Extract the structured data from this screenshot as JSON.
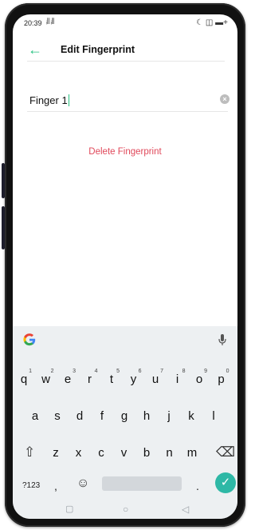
{
  "status_bar": {
    "time": "20:39",
    "signal": "ᵢ⦀ ᵢ⦀",
    "icons_right": "☾ ◫ ▬+"
  },
  "app_bar": {
    "back_icon": "arrow-left-icon",
    "title": "Edit Fingerprint"
  },
  "name_field": {
    "value": "Finger 1"
  },
  "delete_label": "Delete Fingerprint",
  "colors": {
    "accent": "#27c281",
    "danger": "#e0485a",
    "enter": "#2eb8a6",
    "keyboard_bg": "#edf0f2"
  },
  "keyboard": {
    "row1": [
      {
        "k": "q",
        "n": "1"
      },
      {
        "k": "w",
        "n": "2"
      },
      {
        "k": "e",
        "n": "3"
      },
      {
        "k": "r",
        "n": "4"
      },
      {
        "k": "t",
        "n": "5"
      },
      {
        "k": "y",
        "n": "6"
      },
      {
        "k": "u",
        "n": "7"
      },
      {
        "k": "i",
        "n": "8"
      },
      {
        "k": "o",
        "n": "9"
      },
      {
        "k": "p",
        "n": "0"
      }
    ],
    "row2": [
      "a",
      "s",
      "d",
      "f",
      "g",
      "h",
      "j",
      "k",
      "l"
    ],
    "row3": [
      "z",
      "x",
      "c",
      "v",
      "b",
      "n",
      "m"
    ],
    "symbols_label": "?123",
    "comma": ",",
    "period": "."
  }
}
